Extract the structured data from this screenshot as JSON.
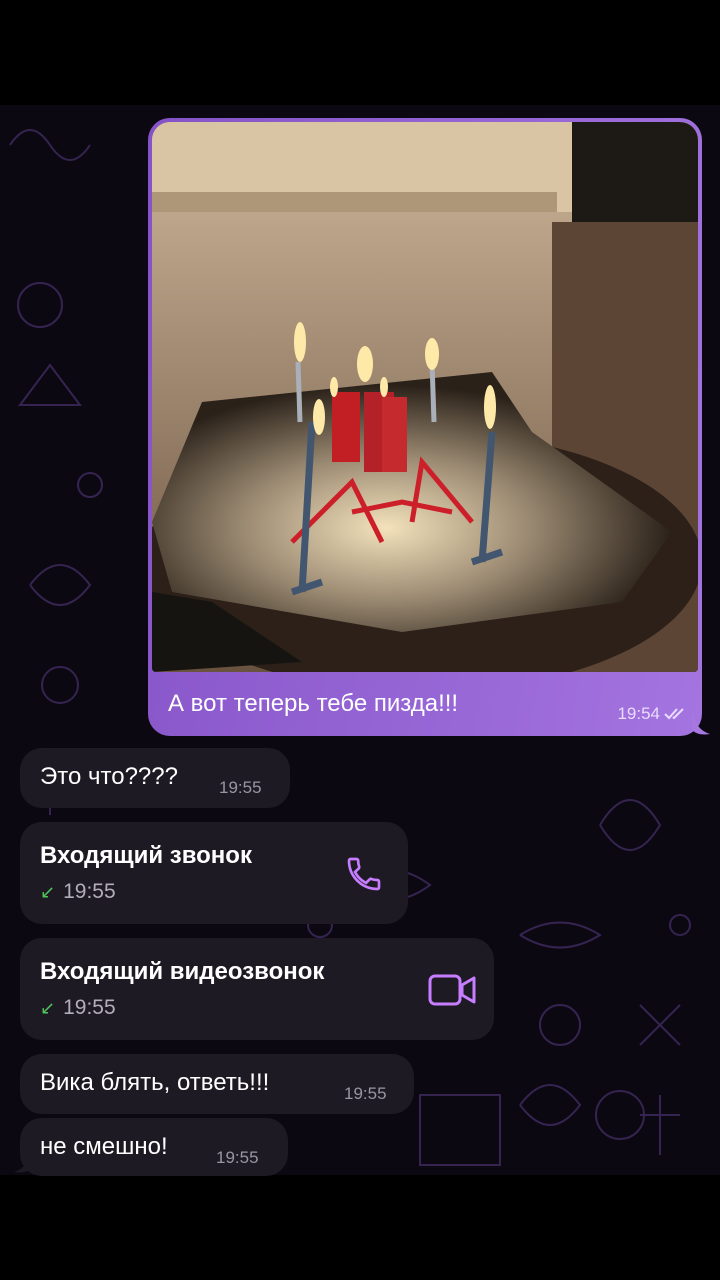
{
  "messages": {
    "outgoing_photo": {
      "caption": "А вот теперь тебе пизда!!!",
      "time": "19:54"
    },
    "incoming": [
      {
        "text": "Это что????",
        "time": "19:55"
      },
      {
        "call_type": "Входящий звонок",
        "time": "19:55",
        "icon": "phone-icon"
      },
      {
        "call_type": "Входящий видеозвонок",
        "time": "19:55",
        "icon": "video-camera-icon"
      },
      {
        "text": "Вика блять, ответь!!!",
        "time": "19:55"
      },
      {
        "text": "не смешно!",
        "time": "19:55"
      }
    ]
  },
  "colors": {
    "outgoing_bubble": "#9b6bd9",
    "incoming_bubble": "#1d1a23",
    "chat_background": "#0c0812",
    "call_icon": "#c77dff",
    "incoming_arrow": "#4fc45b"
  }
}
